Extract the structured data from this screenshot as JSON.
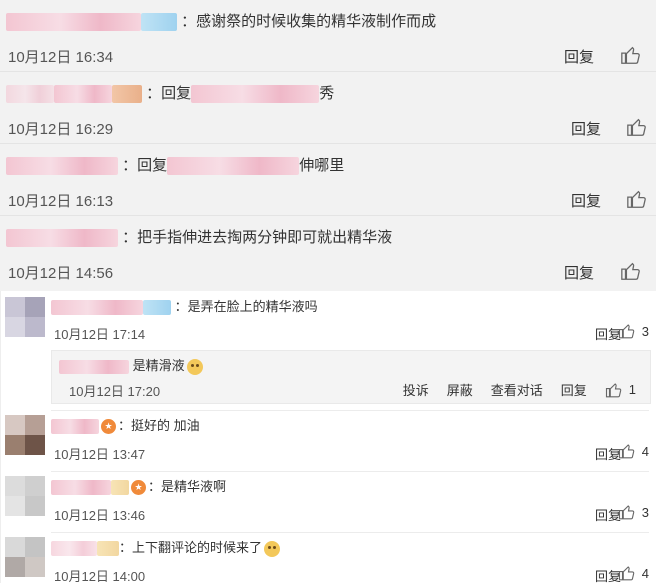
{
  "top_comments": [
    {
      "text": "：感谢祭的时候收集的精华液制作而成",
      "time": "10月12日 16:34",
      "reply": "回复"
    },
    {
      "text_prefix": "：回复",
      "text_suffix": "秀",
      "time": "10月12日 16:29",
      "reply": "回复"
    },
    {
      "text_prefix": "：回复",
      "text_suffix": "伸哪里",
      "time": "10月12日 16:13",
      "reply": "回复"
    },
    {
      "text": "：把手指伸进去掏两分钟即可就出精华液",
      "time": "10月12日 14:56",
      "reply": "回复"
    }
  ],
  "bottom_comments": [
    {
      "text": "：是弄在脸上的精华液吗",
      "time": "10月12日 17:14",
      "reply": "回复",
      "likes": "3"
    },
    {
      "text": "：挺好的 加油",
      "time": "10月12日 13:47",
      "reply": "回复",
      "likes": "4"
    },
    {
      "text": "：是精华液啊",
      "time": "10月12日 13:46",
      "reply": "回复",
      "likes": "3"
    },
    {
      "text": "：上下翻评论的时候来了",
      "time": "10月12日 14:00",
      "reply": "回复",
      "likes": "4"
    }
  ],
  "sub_reply": {
    "text": "是精滑液",
    "time": "10月12日 17:20",
    "actions": {
      "report": "投诉",
      "block": "屏蔽",
      "view": "查看对话",
      "reply": "回复"
    },
    "likes": "1"
  },
  "icons": {
    "like": "thumb-up-icon",
    "emoji": "smile-emoji-icon"
  },
  "colors": {
    "top_bg": "#f2f2f2",
    "blur_pink": "#f3c6d2",
    "blur_blue": "#9fd2ef"
  }
}
